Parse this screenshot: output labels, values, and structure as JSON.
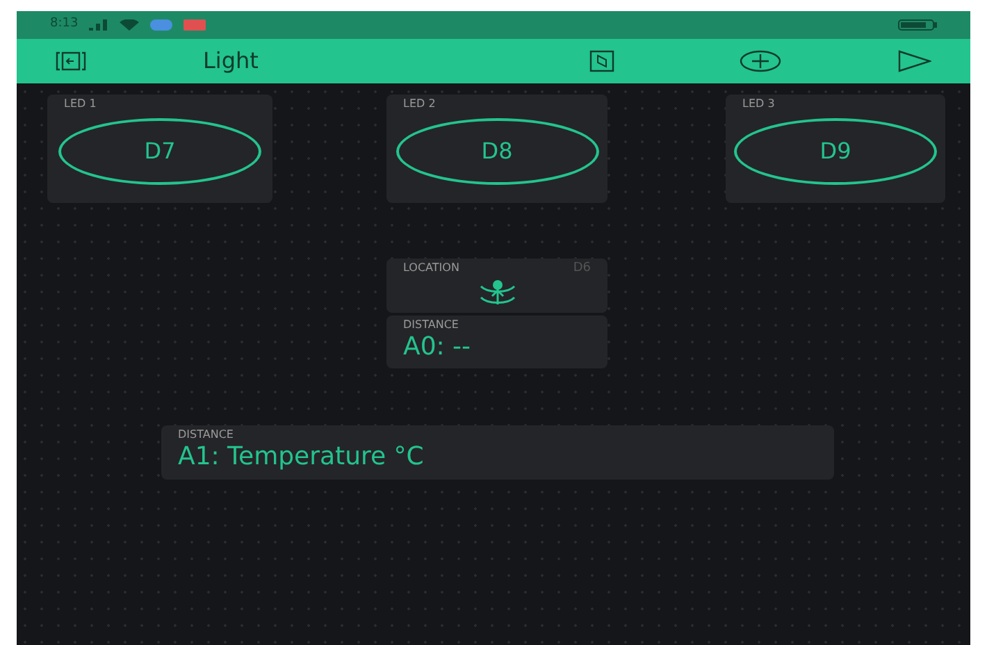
{
  "status_bar": {
    "time": "8:13"
  },
  "toolbar": {
    "title": "Light"
  },
  "widgets": [
    {
      "kind": "button",
      "label": "LED 1",
      "pin": "D7"
    },
    {
      "kind": "button",
      "label": "LED 2",
      "pin": "D8"
    },
    {
      "kind": "button",
      "label": "LED 3",
      "pin": "D9"
    },
    {
      "kind": "gps",
      "label": "LOCATION",
      "pin": "D6"
    },
    {
      "kind": "display",
      "label": "DISTANCE",
      "value": "A0: --"
    },
    {
      "kind": "display",
      "label": "DISTANCE",
      "value": "A1: Temperature °C"
    }
  ]
}
